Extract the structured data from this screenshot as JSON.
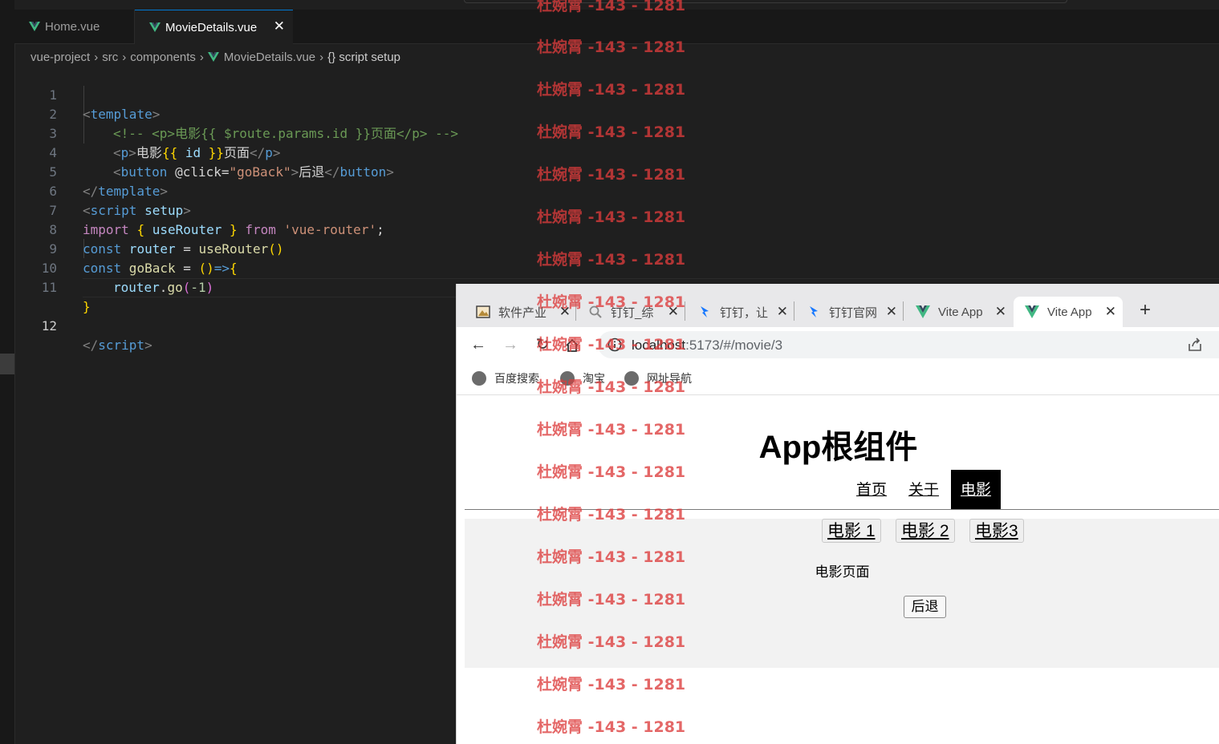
{
  "editor": {
    "tabs": [
      {
        "label": "Home.vue"
      },
      {
        "label": "MovieDetails.vue",
        "close": "✕"
      }
    ],
    "breadcrumb": [
      "vue-project",
      "src",
      "components",
      "MovieDetails.vue",
      "{} script setup"
    ],
    "line_numbers": [
      "1",
      "2",
      "3",
      "4",
      "5",
      "6",
      "7",
      "8",
      "9",
      "10",
      "11",
      "12"
    ],
    "code": {
      "l1": [
        "<",
        "template",
        ">"
      ],
      "l2": "<!-- <p>电影{{ $route.params.id }}页面</p> -->",
      "l3": [
        "<",
        "p",
        ">",
        "电影",
        "{{",
        " id ",
        "}}",
        "页面",
        "</",
        "p",
        ">"
      ],
      "l4": [
        "<",
        "button",
        " @click",
        "=",
        "\"goBack\"",
        ">",
        "后退",
        "</",
        "button",
        ">"
      ],
      "l5": [
        "</",
        "template",
        ">"
      ],
      "l6": [
        "<",
        "script",
        " setup",
        ">"
      ],
      "l7": [
        "import",
        " ",
        "{",
        " useRouter ",
        "}",
        " from ",
        "'vue-router'",
        ";"
      ],
      "l8": [
        "const",
        " router ",
        "=",
        " useRouter",
        "()"
      ],
      "l9": [
        "const",
        " goBack ",
        "=",
        " ",
        "()",
        "=>",
        "{"
      ],
      "l10": [
        "router",
        ".",
        "go",
        "(",
        "-1",
        ")"
      ],
      "l11": "}",
      "l12": [
        "</",
        "script",
        ">"
      ]
    }
  },
  "browser": {
    "tabs": [
      {
        "label": "软件产业",
        "icon": "image-icon"
      },
      {
        "label": "钉钉_综",
        "icon": "search-icon"
      },
      {
        "label": "钉钉，让",
        "icon": "dingtalk-icon"
      },
      {
        "label": "钉钉官网",
        "icon": "dingtalk-icon"
      },
      {
        "label": "Vite App",
        "icon": "vue-icon"
      },
      {
        "label": "Vite App",
        "icon": "vue-icon"
      }
    ],
    "new_tab": "+",
    "tab_close": "✕",
    "url_host": "localhost",
    "url_rest": ":5173/#/movie/3",
    "bookmarks": [
      "百度搜索",
      "淘宝",
      "网址导航"
    ],
    "page": {
      "title": "App根组件",
      "nav": [
        "首页",
        "关于",
        "电影"
      ],
      "movies": [
        "电影 1",
        "电影 2",
        "电影3"
      ],
      "text": "电影页面",
      "back": "后退"
    }
  },
  "watermark": "杜婉霄 -143 - 1281",
  "colors": {
    "accent": "#0078d4",
    "vue_green": "#41b883",
    "watermark": "#dc3c3c"
  }
}
